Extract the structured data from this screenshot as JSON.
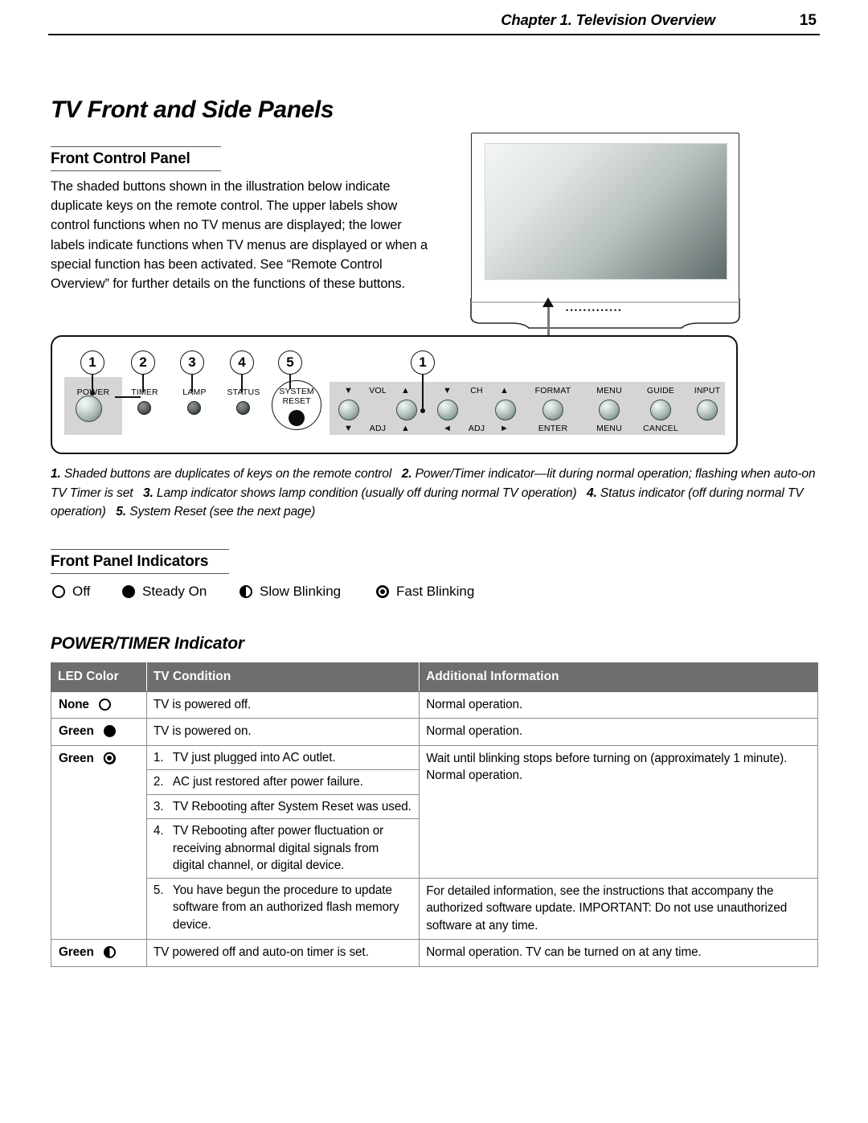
{
  "header": {
    "chapter": "Chapter 1. Television Overview",
    "page_number": "15"
  },
  "title": "TV Front and Side Panels",
  "sections": {
    "front_control_panel": {
      "heading": "Front Control Panel",
      "paragraph": "The shaded buttons shown in the illustration below indicate duplicate keys on the remote control.  The upper labels show control functions when no TV menus are displayed; the lower labels indicate functions when TV menus are displayed or when a special function has been activated.  See “Remote Control Overview” for further details on the functions of these buttons."
    },
    "front_panel_indicators": {
      "heading": "Front Panel Indicators",
      "legend": [
        {
          "icon": "circle-outline-icon",
          "label": "Off"
        },
        {
          "icon": "circle-filled-icon",
          "label": "Steady On"
        },
        {
          "icon": "circle-half-filled-icon",
          "label": "Slow Blinking"
        },
        {
          "icon": "circle-concentric-icon",
          "label": "Fast Blinking"
        }
      ]
    },
    "power_timer": {
      "heading": "POWER/TIMER Indicator"
    }
  },
  "control_panel": {
    "callouts": [
      "1",
      "2",
      "3",
      "4",
      "5",
      "1"
    ],
    "indicators": [
      {
        "label": "POWER",
        "shaded": true
      },
      {
        "label": "TIMER",
        "shaded": false
      },
      {
        "label": "LAMP",
        "shaded": false
      },
      {
        "label": "STATUS",
        "shaded": false
      }
    ],
    "system_reset": {
      "line1": "SYSTEM",
      "line2": "RESET"
    },
    "keys": [
      {
        "top_left": "▼",
        "top_center": "VOL",
        "top_right": "",
        "bottom_left": "▼",
        "bottom_center": "ADJ",
        "bottom_right": ""
      },
      {
        "top_left": "",
        "top_center": "",
        "top_right": "▲",
        "bottom_left": "",
        "bottom_center": "",
        "bottom_right": "▲"
      },
      {
        "top_left": "▼",
        "top_center": "CH",
        "top_right": "",
        "bottom_left": "◄",
        "bottom_center": "ADJ",
        "bottom_right": ""
      },
      {
        "top_left": "",
        "top_center": "",
        "top_right": "▲",
        "bottom_left": "",
        "bottom_center": "",
        "bottom_right": "►"
      }
    ],
    "key_labels": {
      "vol": "VOL",
      "ch": "CH",
      "adj_left": "ADJ",
      "adj_right": "ADJ",
      "down_tri": "▼",
      "up_tri": "▲",
      "left_tri": "◄",
      "right_tri": "►",
      "format_top": "FORMAT",
      "format_bottom": "ENTER",
      "menu_top": "MENU",
      "menu_bottom": "MENU",
      "guide_top": "GUIDE",
      "guide_bottom": "CANCEL",
      "input_top": "INPUT",
      "input_bottom": ""
    },
    "caption": {
      "n1": "1.",
      "t1": "Shaded buttons are duplicates of keys on the remote control",
      "n2": "2.",
      "t2": "Power/Timer indicator—lit during normal operation; flashing when auto-on TV Timer is set",
      "n3": "3.",
      "t3": "Lamp indicator shows lamp condition (usually off during normal TV operation)",
      "n4": "4.",
      "t4": "Status indicator (off during normal TV operation)",
      "n5": "5.",
      "t5": "System Reset (see the next page)"
    }
  },
  "table": {
    "headers": [
      "LED Color",
      "TV Condition",
      "Additional Information"
    ],
    "rows": [
      {
        "led_label": "None",
        "led_icon": "circle-outline-icon",
        "condition": "TV is powered off.",
        "info": "Normal operation."
      },
      {
        "led_label": "Green",
        "led_icon": "circle-filled-icon",
        "condition": "TV is powered on.",
        "info": "Normal operation."
      },
      {
        "led_label": "Green",
        "led_icon": "circle-concentric-icon",
        "items": [
          {
            "n": "1.",
            "t": "TV just plugged into AC outlet."
          },
          {
            "n": "2.",
            "t": "AC just restored after power failure."
          },
          {
            "n": "3.",
            "t": "TV Rebooting after System Reset was used."
          },
          {
            "n": "4.",
            "t": "TV Rebooting after power fluctuation or receiving abnormal digital signals from digital channel, or digital device."
          },
          {
            "n": "5.",
            "t": "You have begun the procedure to update software from an authorized flash memory device."
          }
        ],
        "info_a": "Wait until blinking stops before turning on (approximately 1 minute).  Normal operation.",
        "info_b": "For detailed information, see the instructions that accompany the authorized software update.  IMPORTANT:  Do not use unauthorized software at any time."
      },
      {
        "led_label": "Green",
        "led_icon": "circle-half-filled-icon",
        "condition": "TV powered off and auto-on timer is set.",
        "info": "Normal operation.  TV can be turned on at any time."
      }
    ]
  },
  "colors": {
    "table_header_bg": "#6e6e6e",
    "shaded_key_bg": "#d5d5d5",
    "rule": "#000000"
  }
}
